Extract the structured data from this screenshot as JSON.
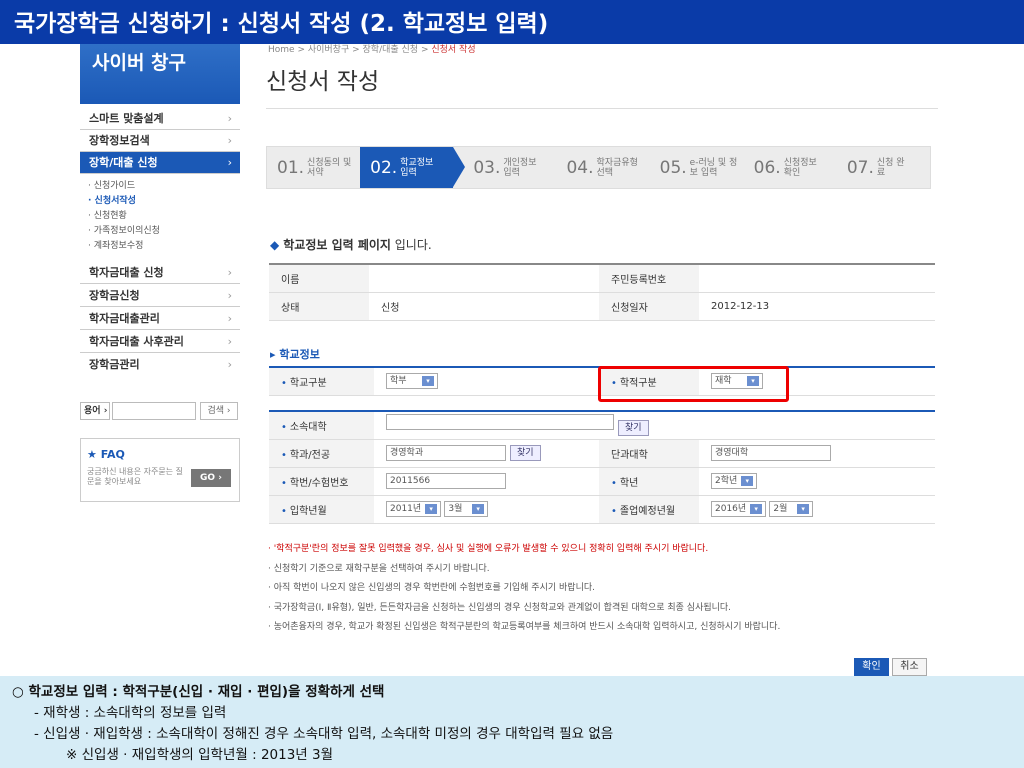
{
  "slide_title": "국가장학금 신청하기 : 신청서 작성 (2. 학교정보 입력)",
  "sidebar": {
    "header": "사이버 창구",
    "menu": [
      "스마트 맞춤설계",
      "장학정보검색",
      "장학/대출 신청",
      "학자금대출 신청",
      "장학금신청",
      "학자금대출관리",
      "학자금대출 사후관리",
      "장학금관리"
    ],
    "chev": "›",
    "submenu": [
      "· 신청가이드",
      "· 신청서작성",
      "· 신청현황",
      "· 가족정보이의신청",
      "· 계좌정보수정"
    ],
    "search_label": "용어 ›",
    "search_button": "검색 ›",
    "faq_title": "FAQ",
    "faq_desc": "궁금하신 내용은 자주묻는 질문을 찾아보세요",
    "faq_go": "GO ›"
  },
  "breadcrumb": {
    "path": "Home > 사이버창구 > 장학/대출 신청 > ",
    "current": "신청서 작성"
  },
  "page_title": "신청서 작성",
  "steps": [
    {
      "num": "01.",
      "label": "신청동의 및 서약"
    },
    {
      "num": "02.",
      "label": "학교정보 입력"
    },
    {
      "num": "03.",
      "label": "개인정보 입력"
    },
    {
      "num": "04.",
      "label": "학자금유형 선택"
    },
    {
      "num": "05.",
      "label": "e-러닝 및 정보 입력"
    },
    {
      "num": "06.",
      "label": "신청정보 확인"
    },
    {
      "num": "07.",
      "label": "신청 완료"
    }
  ],
  "section1": {
    "bullet": "◆",
    "bold": "학교정보 입력 페이지",
    "rest": " 입니다."
  },
  "info": {
    "name_label": "이름",
    "name_value": "",
    "rrn_label": "주민등록번호",
    "rrn_value": "",
    "status_label": "상태",
    "status_value": "신청",
    "date_label": "신청일자",
    "date_value": "2012-12-13"
  },
  "section2": "▸ 학교정보",
  "school": {
    "type_label": "학교구분",
    "type_value": "학부",
    "enroll_label": "학적구분",
    "enroll_value": "재학",
    "univ_label": "소속대학",
    "univ_value": "",
    "search_btn": "찾기",
    "major_label": "학과/전공",
    "major_value": "경영학과",
    "college_label": "단과대학",
    "college_value": "경영대학",
    "stuid_label": "학번/수험번호",
    "stuid_value": "2011566",
    "grade_label": "학년",
    "grade_value": "2학년",
    "admit_label": "입학년월",
    "admit_year": "2011년",
    "admit_month": "3월",
    "grad_label": "졸업예정년월",
    "grad_year": "2016년",
    "grad_month": "2월",
    "dot": "•",
    "arrow": "▾"
  },
  "notes": [
    "· '학적구분'란의 정보를 잘못 입력했을 경우, 심사 및 실행에 오류가 발생할 수 있으니 정확히 입력해 주시기 바랍니다.",
    "· 신청학기 기준으로 재학구분을 선택하여 주시기 바랍니다.",
    "· 아직 학번이 나오지 않은 신입생의 경우 학번란에 수험번호를 기입해 주시기 바랍니다.",
    "· 국가장학금(Ⅰ, Ⅱ유형), 일반, 든든학자금을 신청하는 신입생의 경우 신청학교와 관계없이 합격된 대학으로 최종 심사됩니다.",
    "· 농어촌융자의 경우, 학교가 확정된 신입생은 학적구분란의 학교등록여부를 체크하여 반드시 소속대학 입력하시고, 신청하시기 바랍니다."
  ],
  "buttons": {
    "confirm": "확인",
    "cancel": "취소"
  },
  "bottom": [
    "○ 학교정보 입력 : 학적구분(신입 · 재입 · 편입)을 정확하게 선택",
    "- 재학생 : 소속대학의 정보를 입력",
    "- 신입생 · 재입학생 : 소속대학이 정해진 경우 소속대학 입력, 소속대학 미정의 경우 대학입력 필요 없음",
    "※ 신입생 · 재입학생의 입학년월 : 2013년 3월"
  ]
}
